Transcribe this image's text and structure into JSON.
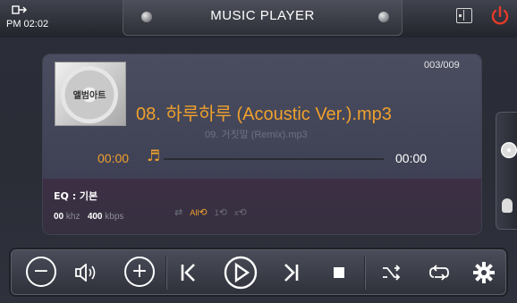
{
  "status": {
    "time": "PM 02:02",
    "signal_icon": "sync-icon"
  },
  "header": {
    "title": "MUSIC PLAYER",
    "icons": [
      "screen-toggle-icon",
      "power-icon"
    ]
  },
  "player": {
    "album_label": "앨범아트",
    "track_count": "003/009",
    "current_track": "08. 하루하루 (Acoustic Ver.).mp3",
    "next_track": "09. 거짓말 (Remix).mp3",
    "elapsed": "00:00",
    "duration": "00:00",
    "progress_fraction": 0,
    "accent_color": "#f0a02c"
  },
  "eq": {
    "label": "EQ : 기본",
    "khz_value": "00",
    "khz_unit": "khz",
    "kbps_value": "400",
    "kbps_unit": "kbps",
    "modes": [
      "shuffle",
      "repeat-all",
      "repeat-one",
      "repeat-off"
    ],
    "mode_labels": [
      "",
      "All",
      "1",
      "x"
    ],
    "active_mode": "repeat-all"
  },
  "side_panel": {
    "icons": [
      "cd-icon",
      "microphone-icon"
    ]
  },
  "controls": {
    "buttons": [
      "volume-down",
      "volume-mute",
      "volume-up",
      "previous",
      "play",
      "next",
      "stop",
      "shuffle",
      "repeat",
      "settings"
    ]
  }
}
